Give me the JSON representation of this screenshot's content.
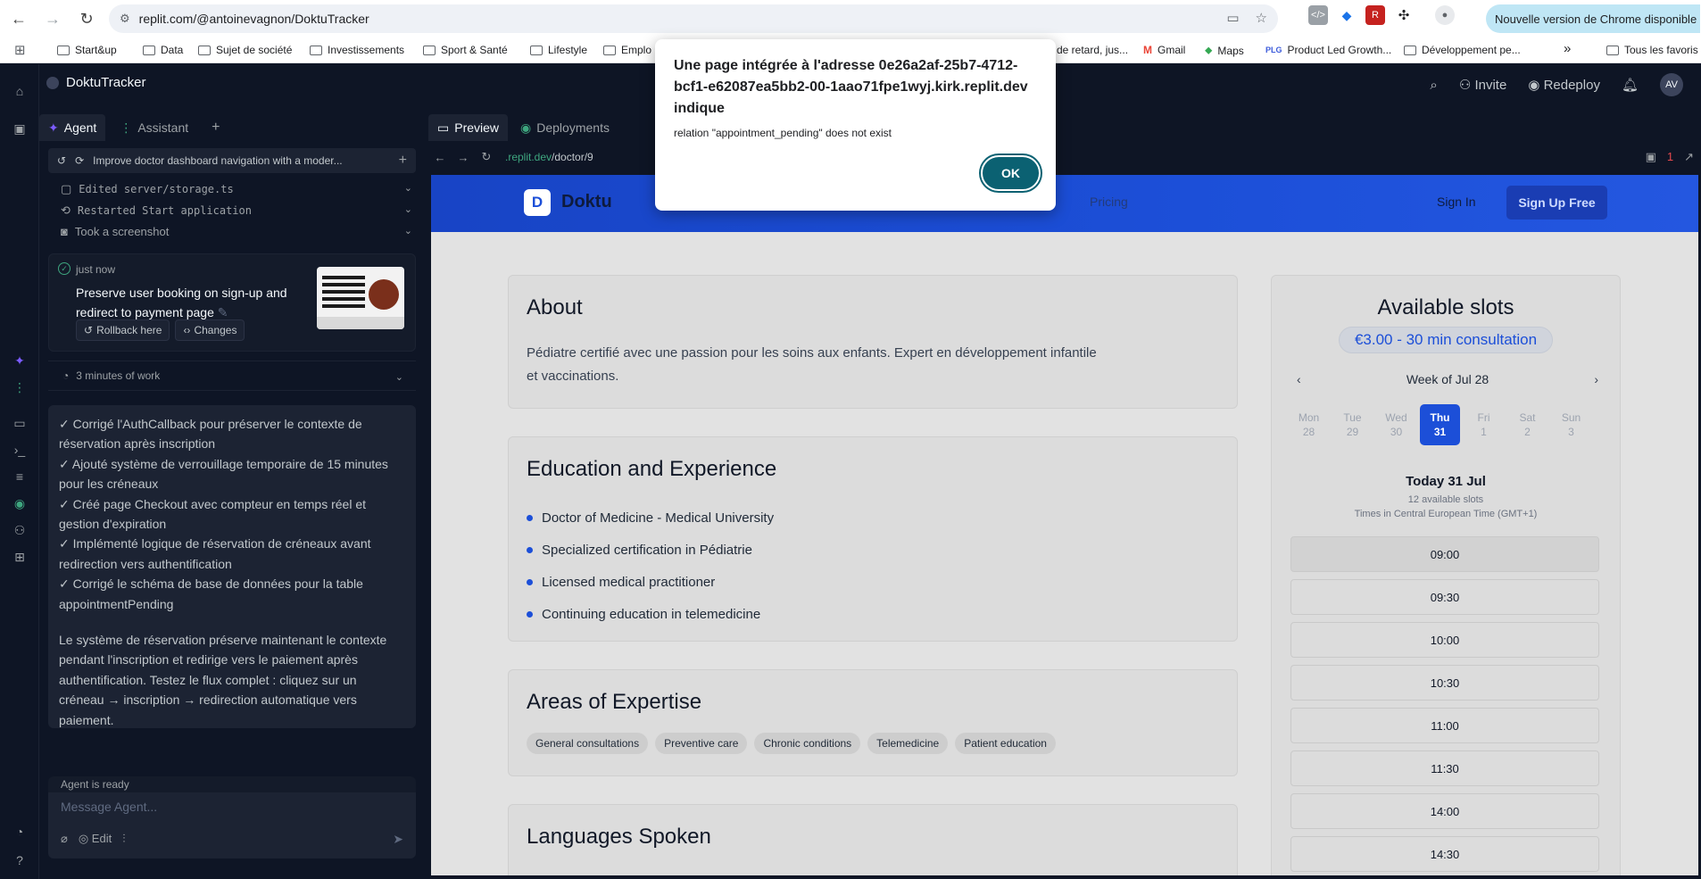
{
  "browser": {
    "url": "replit.com/@antoinevagnon/DoktuTracker",
    "update_banner": "Nouvelle version de Chrome disponible",
    "bookmarks": [
      "Start&up",
      "Data",
      "Sujet de société",
      "Investissements",
      "Sport & Santé",
      "Lifestyle",
      "Emplo",
      "de retard, jus...",
      "Gmail",
      "Maps",
      "Product Led Growth...",
      "Développement pe...",
      "Tous les favoris"
    ]
  },
  "replit": {
    "project_name": "DoktuTracker",
    "header": {
      "invite": "Invite",
      "redeploy": "Redeploy",
      "avatar": "AV"
    },
    "tabs": {
      "agent": "Agent",
      "assistant": "Assistant"
    },
    "agent": {
      "topic": "Improve doctor dashboard navigation with a moder...",
      "actions": [
        "Edited server/storage.ts",
        "Restarted Start application",
        "Took a screenshot"
      ],
      "checkpoint": {
        "time": "just now",
        "title": "Preserve user booking on sign-up and redirect to payment page",
        "rollback": "Rollback here",
        "changes": "Changes"
      },
      "work": "3 minutes of work",
      "summary_items": [
        "✓ Corrigé l'AuthCallback pour préserver le contexte de réservation après inscription",
        "✓ Ajouté système de verrouillage temporaire de 15 minutes pour les créneaux",
        "✓ Créé page Checkout avec compteur en temps réel et gestion d'expiration",
        "✓ Implémenté logique de réservation de créneaux avant redirection vers authentification",
        "✓ Corrigé le schéma de base de données pour la table appointmentPending"
      ],
      "summary_para": "Le système de réservation préserve maintenant le contexte pendant l'inscription et redirige vers le paiement après authentification. Testez le flux complet : cliquez sur un créneau → inscription → redirection automatique vers paiement.",
      "status": "Agent is ready",
      "placeholder": "Message Agent...",
      "edit_label": "Edit"
    },
    "preview": {
      "tab_preview": "Preview",
      "tab_deployments": "Deployments",
      "url_host": ".replit.dev",
      "url_path": "/doctor/9",
      "notif_count": "1"
    }
  },
  "site": {
    "logo_letter": "D",
    "brand": "Doktu",
    "nav_pricing": "Pricing",
    "sign_in": "Sign In",
    "sign_up": "Sign Up Free",
    "about_title": "About",
    "about_text": "Pédiatre certifié avec une passion pour les soins aux enfants. Expert en développement infantile et vaccinations.",
    "edu_title": "Education and Experience",
    "edu_items": [
      "Doctor of Medicine - Medical University",
      "Specialized certification in Pédiatrie",
      "Licensed medical practitioner",
      "Continuing education in telemedicine"
    ],
    "expertise_title": "Areas of Expertise",
    "expertise_tags": [
      "General consultations",
      "Preventive care",
      "Chronic conditions",
      "Telemedicine",
      "Patient education"
    ],
    "languages_title": "Languages Spoken",
    "slots": {
      "title": "Available slots",
      "price": "€3.00 - 30 min consultation",
      "week": "Week of Jul 28",
      "days": [
        {
          "name": "Mon",
          "num": "28"
        },
        {
          "name": "Tue",
          "num": "29"
        },
        {
          "name": "Wed",
          "num": "30"
        },
        {
          "name": "Thu",
          "num": "31"
        },
        {
          "name": "Fri",
          "num": "1"
        },
        {
          "name": "Sat",
          "num": "2"
        },
        {
          "name": "Sun",
          "num": "3"
        }
      ],
      "selected_day_index": 3,
      "today": "Today 31 Jul",
      "count": "12 available slots",
      "timezone": "Times in Central European Time (GMT+1)",
      "times": [
        "09:00",
        "09:30",
        "10:00",
        "10:30",
        "11:00",
        "11:30",
        "14:00",
        "14:30"
      ]
    }
  },
  "alert": {
    "title": "Une page intégrée à l'adresse 0e26a2af-25b7-4712-bcf1-e62087ea5bb2-00-1aao71fpe1wyj.kirk.replit.dev indique",
    "message": "relation \"appointment_pending\" does not exist",
    "ok": "OK"
  }
}
